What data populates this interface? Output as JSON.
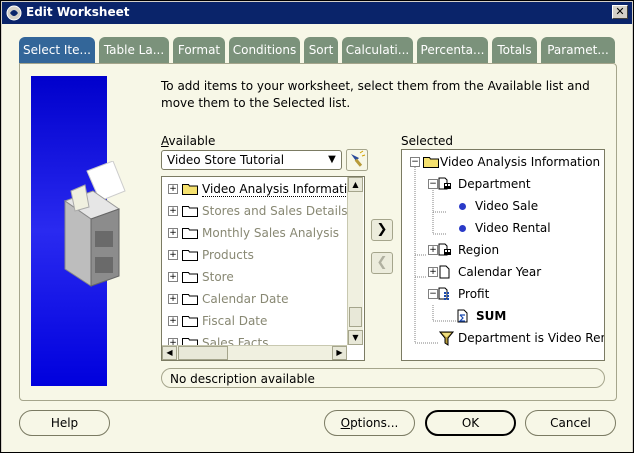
{
  "window": {
    "title": "Edit Worksheet",
    "close_glyph": "✕"
  },
  "tabs": [
    {
      "label": "Select Ite...",
      "active": true
    },
    {
      "label": "Table La..."
    },
    {
      "label": "Format"
    },
    {
      "label": "Conditions"
    },
    {
      "label": "Sort"
    },
    {
      "label": "Calculati..."
    },
    {
      "label": "Percenta..."
    },
    {
      "label": "Totals"
    },
    {
      "label": "Paramet..."
    }
  ],
  "instructions": "To add items to your worksheet, select them from the Available list and move them to the Selected list.",
  "available": {
    "label_prefix": "",
    "label_mnemonic": "A",
    "label_rest": "vailable",
    "business_area": "Video Store Tutorial",
    "items": [
      "Video Analysis Information",
      "Stores and Sales Details",
      "Monthly Sales Analysis",
      "Products",
      "Store",
      "Calendar Date",
      "Fiscal Date",
      "Sales Facts"
    ]
  },
  "selected": {
    "label": "Selected",
    "items": [
      "Video Analysis Information",
      "Department",
      "Video Sale",
      "Video Rental",
      "Region",
      "Calendar Year",
      "Profit",
      "SUM",
      "Department is Video Renta"
    ]
  },
  "move_right_glyph": "❯",
  "move_left_glyph": "❮",
  "description": "No description available",
  "buttons": {
    "help": "Help",
    "options_mnemonic": "O",
    "options_rest": "ptions...",
    "ok": "OK",
    "cancel": "Cancel"
  },
  "colors": {
    "title_bar": "#0a246a",
    "active_tab": "#336699",
    "inactive_tab": "#7b927b",
    "panel_bg": "#f7f7e7",
    "banner_blue": "#0000cc"
  }
}
